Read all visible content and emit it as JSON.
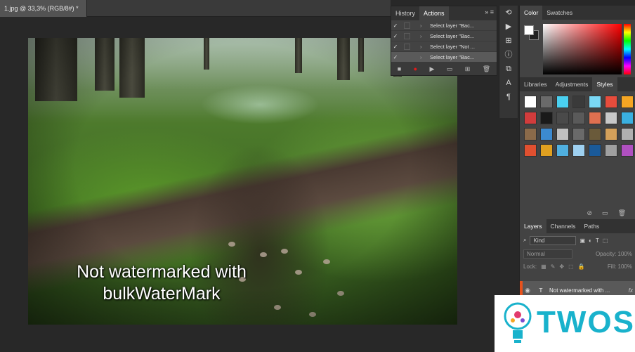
{
  "document": {
    "tab_title": "1.jpg @ 33,3% (RGB/8#) *"
  },
  "canvas": {
    "watermark_lines": [
      "Not watermarked with",
      "bulkWaterMark"
    ]
  },
  "actions_panel": {
    "tabs": [
      {
        "label": "History"
      },
      {
        "label": "Actions"
      }
    ],
    "menu_glyph": "» ≡",
    "rows": [
      {
        "check": "✓",
        "label": "Select layer \"Bac..."
      },
      {
        "check": "✓",
        "label": "Select layer \"Bac..."
      },
      {
        "check": "✓",
        "label": "Select layer \"Not ..."
      },
      {
        "check": "✓",
        "label": "Select layer \"Bac..."
      }
    ]
  },
  "color_panel": {
    "tabs": [
      {
        "label": "Color"
      },
      {
        "label": "Swatches"
      }
    ]
  },
  "styles_panel": {
    "tabs": [
      {
        "label": "Libraries"
      },
      {
        "label": "Adjustments"
      },
      {
        "label": "Styles"
      }
    ],
    "swatch_colors": [
      "#ffffff",
      "#6a6a6a",
      "#4ad0f0",
      "#3a3a3a",
      "#7ad8f5",
      "#e74c3c",
      "#f5a623",
      "#d23c3c",
      "#1a1a1a",
      "#4a4a4a",
      "#5a5a5a",
      "#e07050",
      "#c8c8c8",
      "#3ab0e0",
      "#8a6a4a",
      "#3c8ad0",
      "#c0c0c0",
      "#6a6a6a",
      "#6a5a3a",
      "#d4a05a",
      "#b0b0b0",
      "#e05030",
      "#e0a020",
      "#50b0e0",
      "#9ed0f0",
      "#1a5a9a",
      "#a0a0a0",
      "#b050c0"
    ]
  },
  "layers_panel": {
    "tabs": [
      {
        "label": "Layers"
      },
      {
        "label": "Channels"
      },
      {
        "label": "Paths"
      }
    ],
    "kind_label": "Kind",
    "blend_mode": "Normal",
    "opacity_label": "Opacity:",
    "opacity_value": "100%",
    "lock_label": "Lock:",
    "fill_label": "Fill:",
    "fill_value": "100%",
    "layer_name": "Not watermarked with ...",
    "layer_fx": "fx"
  },
  "logo": {
    "text": "TWOS"
  }
}
